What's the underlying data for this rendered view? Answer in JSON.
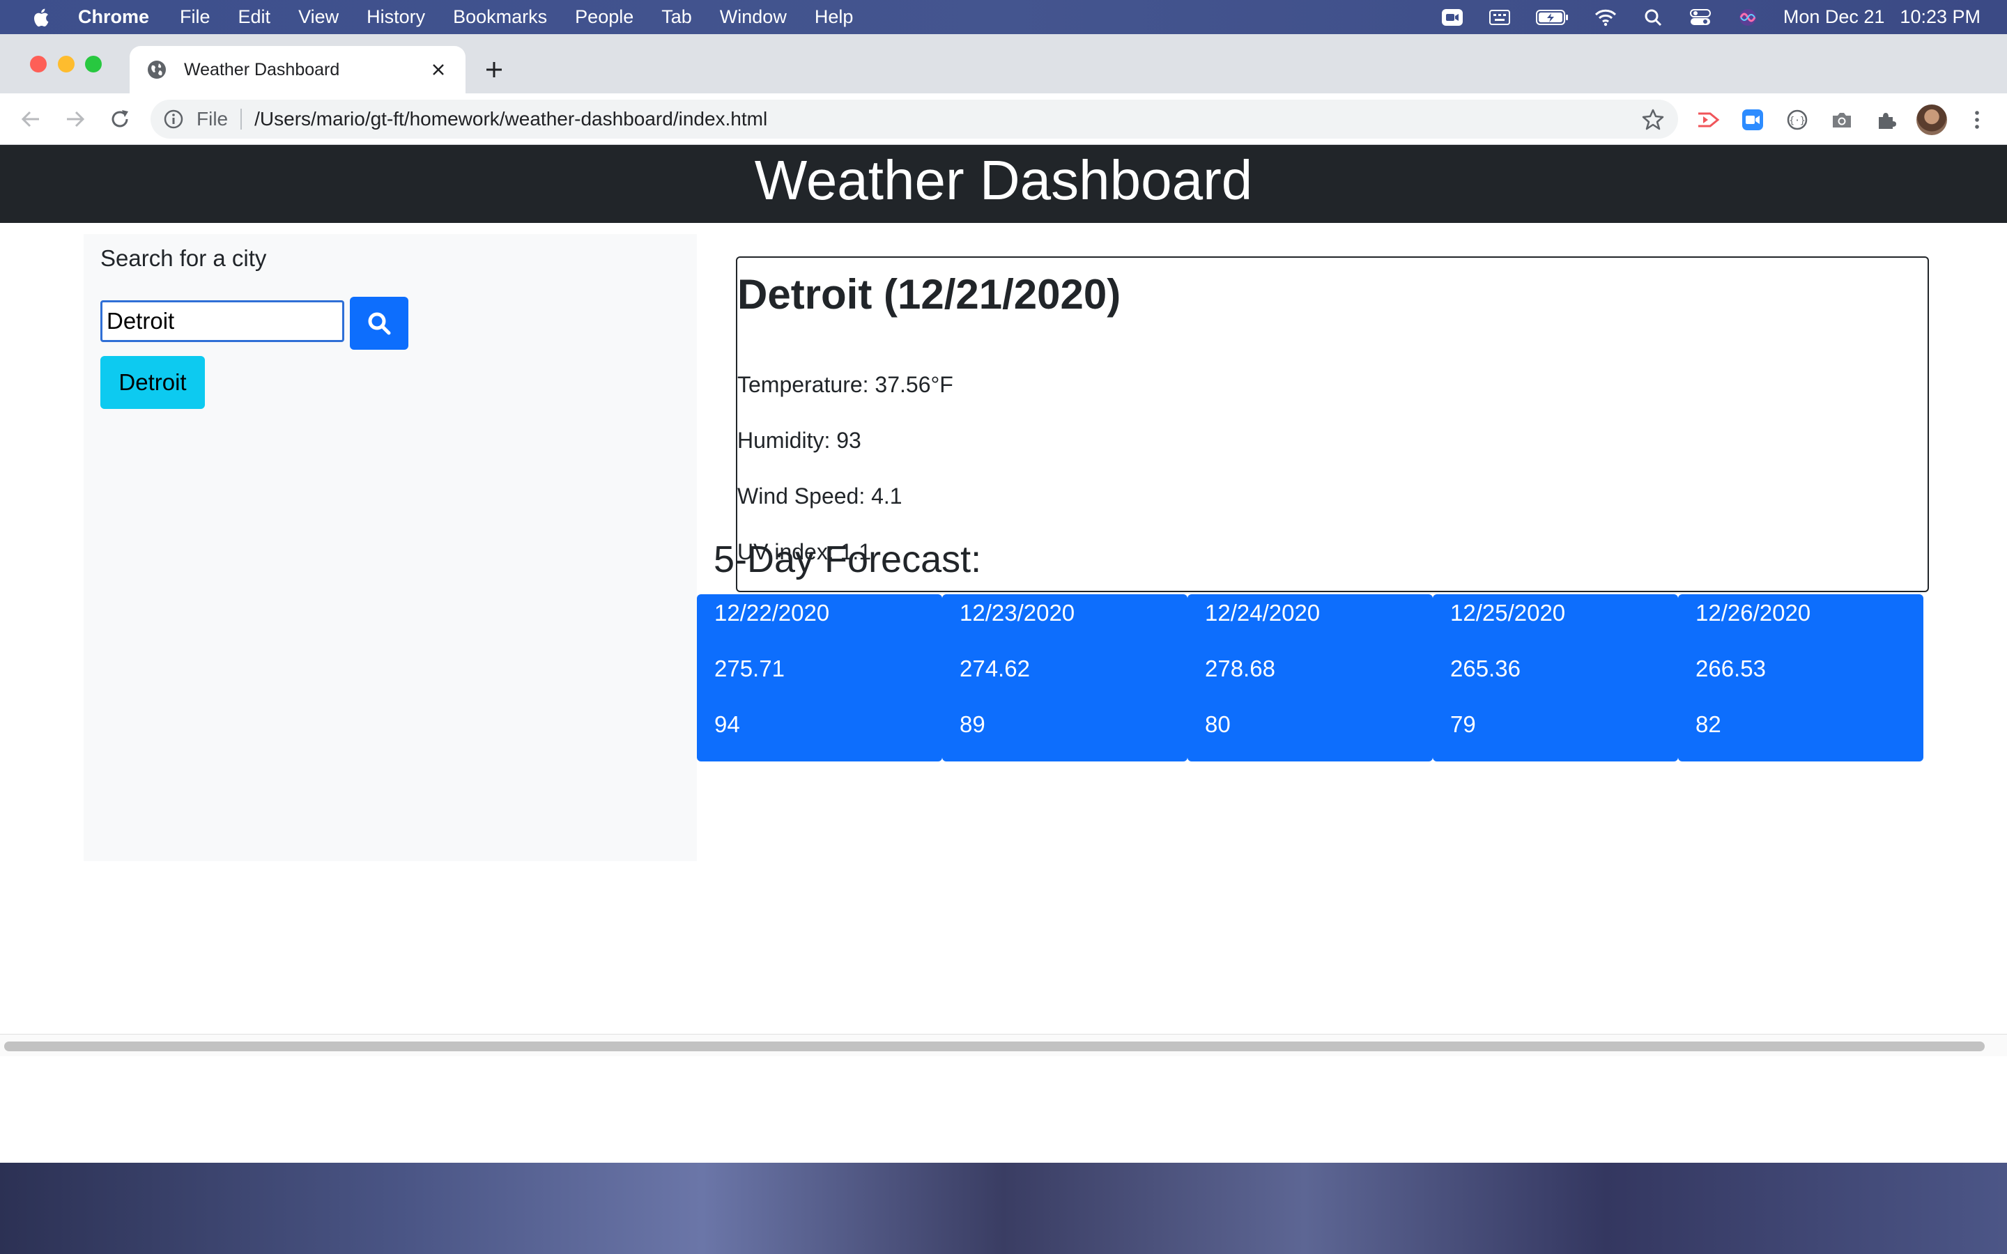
{
  "menubar": {
    "app_name": "Chrome",
    "items": [
      "File",
      "Edit",
      "View",
      "History",
      "Bookmarks",
      "People",
      "Tab",
      "Window",
      "Help"
    ],
    "clock_day": "Mon Dec 21",
    "clock_time": "10:23 PM"
  },
  "browser": {
    "tab_title": "Weather Dashboard",
    "scheme": "File",
    "url": "/Users/mario/gt-ft/homework/weather-dashboard/index.html"
  },
  "page": {
    "header_title": "Weather Dashboard",
    "search_label": "Search for a city",
    "search_value": "Detroit",
    "history_city": "Detroit",
    "current": {
      "title": "Detroit (12/21/2020)",
      "temperature": "Temperature: 37.56°F",
      "humidity": "Humidity: 93",
      "wind": "Wind Speed: 4.1",
      "uv": "UV index: 1.1"
    },
    "forecast_title": "5-Day Forecast:",
    "forecast": [
      {
        "date": "12/22/2020",
        "temp": "275.71",
        "humidity": "94"
      },
      {
        "date": "12/23/2020",
        "temp": "274.62",
        "humidity": "89"
      },
      {
        "date": "12/24/2020",
        "temp": "278.68",
        "humidity": "80"
      },
      {
        "date": "12/25/2020",
        "temp": "265.36",
        "humidity": "79"
      },
      {
        "date": "12/26/2020",
        "temp": "266.53",
        "humidity": "82"
      }
    ]
  },
  "colors": {
    "header_bg": "#212529",
    "primary": "#0d6efd",
    "info": "#0dcaf0",
    "sidebar_bg": "#f8f9fa"
  },
  "icons": [
    "apple-icon",
    "zoom-icon",
    "battery-icon",
    "wifi-icon",
    "search-icon",
    "control-center-icon",
    "siri-icon",
    "globe-icon",
    "close-icon",
    "plus-icon",
    "back-icon",
    "forward-icon",
    "reload-icon",
    "info-icon",
    "star-icon",
    "extensions-icon",
    "menu-icon"
  ]
}
